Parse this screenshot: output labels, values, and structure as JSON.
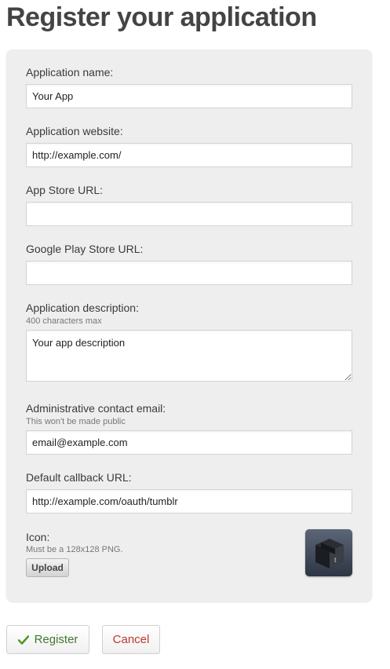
{
  "page": {
    "title": "Register your application"
  },
  "form": {
    "app_name": {
      "label": "Application name:",
      "value": "Your App"
    },
    "app_website": {
      "label": "Application website:",
      "value": "http://example.com/"
    },
    "app_store_url": {
      "label": "App Store URL:",
      "value": ""
    },
    "google_play_url": {
      "label": "Google Play Store URL:",
      "value": ""
    },
    "description": {
      "label": "Application description:",
      "hint": "400 characters max",
      "value": "Your app description"
    },
    "contact_email": {
      "label": "Administrative contact email:",
      "hint": "This won't be made public",
      "value": "email@example.com"
    },
    "callback_url": {
      "label": "Default callback URL:",
      "value": "http://example.com/oauth/tumblr"
    },
    "icon": {
      "label": "Icon:",
      "hint": "Must be a 128x128 PNG.",
      "upload_label": "Upload",
      "preview_letter": "t"
    }
  },
  "actions": {
    "register_label": "Register",
    "cancel_label": "Cancel"
  },
  "colors": {
    "register_text": "#3d7a2e",
    "check": "#4c9a2a",
    "cancel_text": "#c0392b",
    "panel_bg": "#eeeeee",
    "title": "#444444"
  }
}
